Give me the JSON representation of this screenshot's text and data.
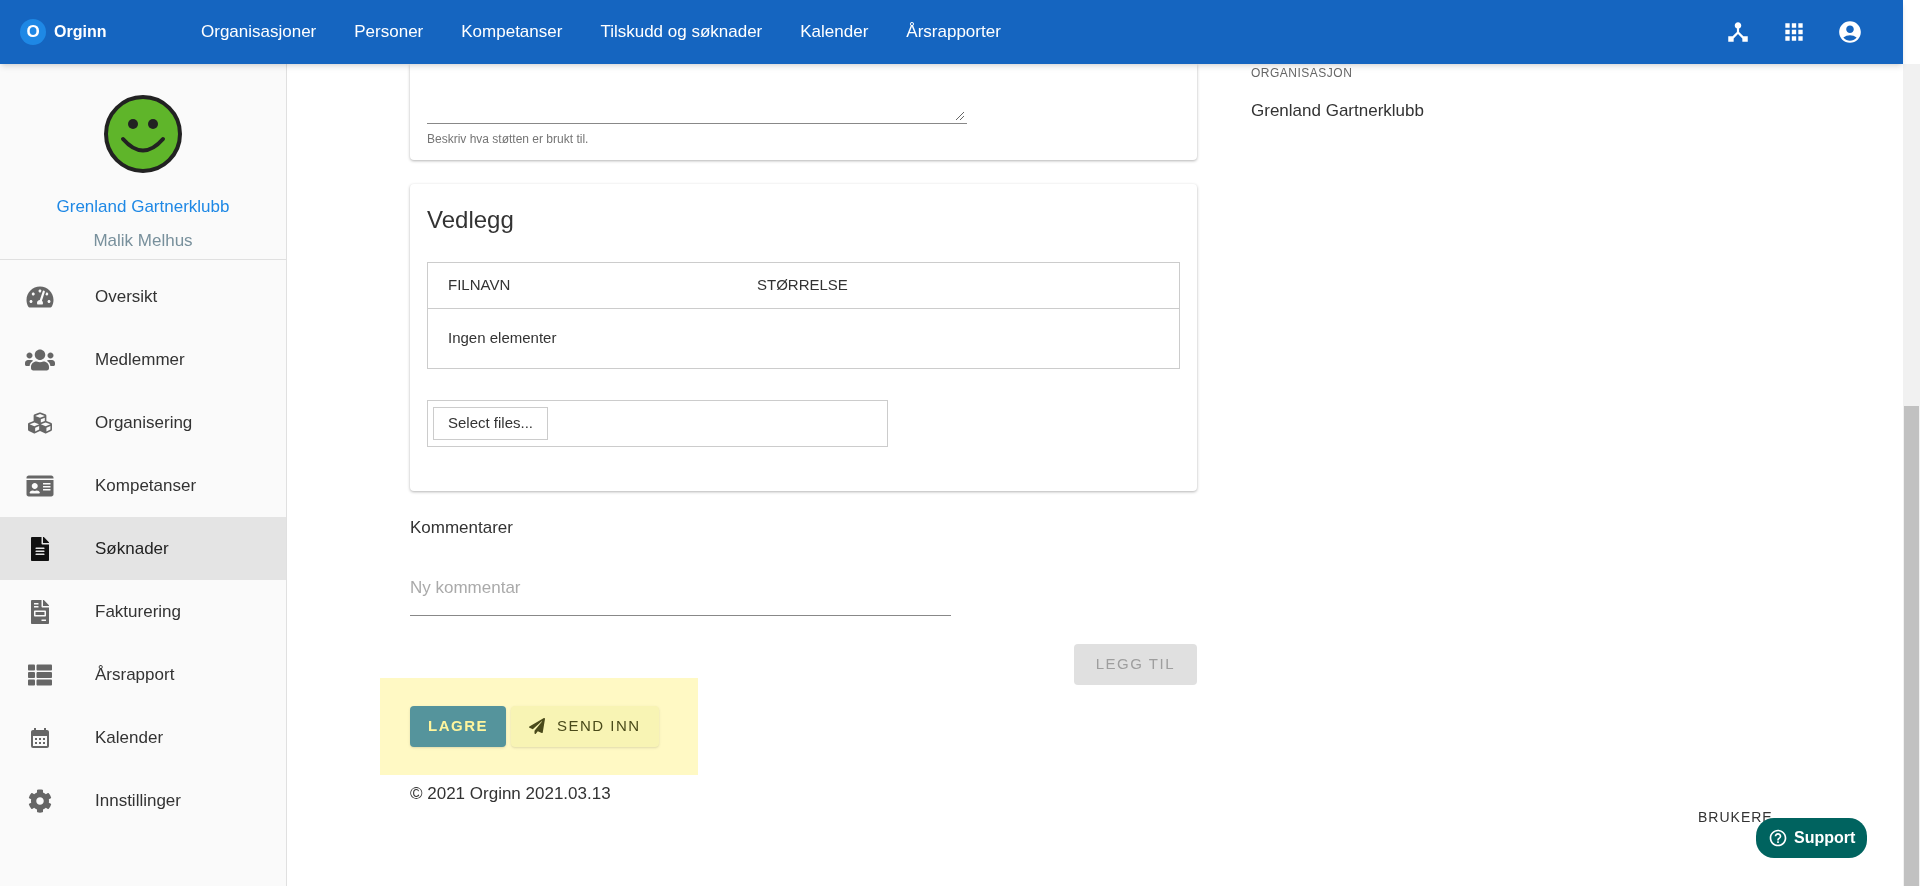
{
  "topbar": {
    "logo_letter": "O",
    "brand": "Orginn",
    "nav": [
      "Organisasjoner",
      "Personer",
      "Kompetanser",
      "Tilskudd og søknader",
      "Kalender",
      "Årsrapporter"
    ]
  },
  "sidebar": {
    "organization": "Grenland Gartnerklubb",
    "user": "Malik Melhus",
    "items": [
      {
        "label": "Oversikt",
        "selected": false
      },
      {
        "label": "Medlemmer",
        "selected": false
      },
      {
        "label": "Organisering",
        "selected": false
      },
      {
        "label": "Kompetanser",
        "selected": false
      },
      {
        "label": "Søknader",
        "selected": true
      },
      {
        "label": "Fakturering",
        "selected": false
      },
      {
        "label": "Årsrapport",
        "selected": false
      },
      {
        "label": "Kalender",
        "selected": false
      },
      {
        "label": "Innstillinger",
        "selected": false
      }
    ]
  },
  "usage_card": {
    "helper_text": "Beskriv hva støtten er brukt til."
  },
  "attachments": {
    "title": "Vedlegg",
    "columns": [
      "FILNAVN",
      "STØRRELSE"
    ],
    "empty_text": "Ingen elementer",
    "select_button": "Select files..."
  },
  "comments": {
    "title": "Kommentarer",
    "placeholder": "Ny kommentar",
    "add_button": {
      "label": "LEGG TIL",
      "disabled": true
    }
  },
  "actions": {
    "highlighted": true,
    "save": "LAGRE",
    "submit": "SEND INN"
  },
  "footer": "© 2021 Orginn 2021.03.13",
  "right_panel": {
    "label": "ORGANISASJON",
    "value": "Grenland Gartnerklubb",
    "users_label": "BRUKERE"
  },
  "support_button": "Support"
}
